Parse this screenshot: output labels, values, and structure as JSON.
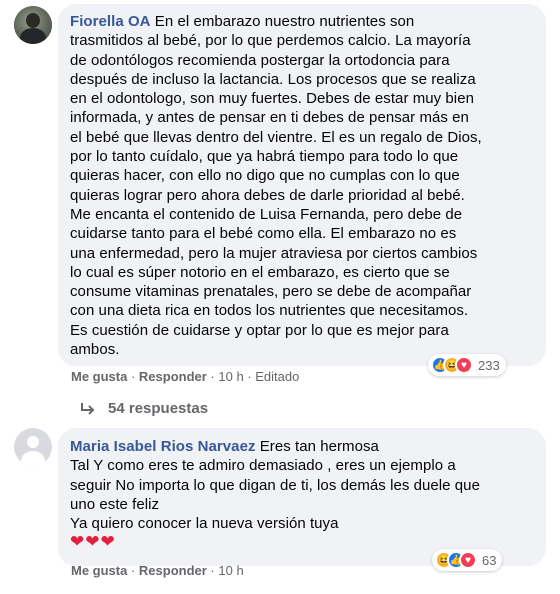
{
  "comments": [
    {
      "author": "Fiorella OA",
      "text": "En el embarazo nuestro nutrientes son\ntrasmitidos al bebé, por lo que perdemos calcio. La mayoría\nde odontólogos recomienda postergar la ortodoncia para\ndespués de incluso la lactancia. Los procesos que se realiza\nen el odontologo, son muy fuertes. Debes de estar muy bien\ninformada, y antes de pensar en ti debes de pensar más en\nel bebé que llevas dentro del vientre. El es un regalo de Dios,\npor lo tanto cuídalo, que ya habrá tiempo para todo lo que\nquieras hacer, con ello no digo que no cumplas con lo que\nquieras lograr pero ahora debes de darle prioridad al bebé.\nMe encanta el contenido de Luisa Fernanda, pero debe de\ncuidarse tanto para el bebé como ella. El embarazo no es\nuna enfermedad, pero la mujer atraviesa por ciertos cambios\nlo cual es súper notorio en el embarazo, es cierto que se\nconsume vitaminas prenatales, pero se debe de acompañar\ncon una dieta rica en todos los nutrientes que necesitamos.\nEs cuestión de cuidarse y optar por lo que es mejor para\nambos.",
      "reaction_count": "233",
      "like": "Me gusta",
      "reply": "Responder",
      "time": "10 h",
      "edited": "Editado",
      "replies_label": "54 respuestas"
    },
    {
      "author": "Maria Isabel Rios Narvaez",
      "text": "Eres tan hermosa\nTal Y como eres te admiro demasiado , eres un ejemplo a\nseguir No importa lo que digan de ti, los demás les duele que\nuno este feliz\nYa quiero conocer la nueva versión tuya",
      "hearts": "❤❤❤",
      "reaction_count": "63",
      "like": "Me gusta",
      "reply": "Responder",
      "time": "10 h"
    }
  ],
  "separator": " · ",
  "colors": {
    "link": "#385898",
    "meta": "#65676b",
    "bubble": "#f0f2f5",
    "like": "#1877f2",
    "love": "#f33e58",
    "haha": "#f7b125"
  },
  "icons": [
    "like-reaction-icon",
    "haha-reaction-icon",
    "love-reaction-icon",
    "reply-arrow-icon"
  ]
}
